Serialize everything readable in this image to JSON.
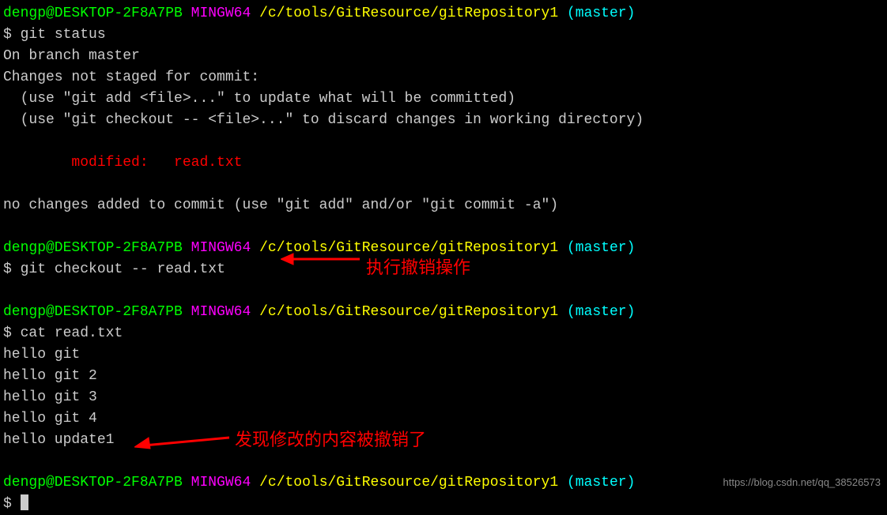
{
  "prompt": {
    "user_host": "dengp@DESKTOP-2F8A7PB",
    "shell": "MINGW64",
    "path": "/c/tools/GitResource/gitRepository1",
    "branch": "(master)",
    "dollar": "$"
  },
  "commands": {
    "status": "git status",
    "checkout": "git checkout -- read.txt",
    "cat": "cat read.txt"
  },
  "output": {
    "on_branch": "On branch master",
    "changes_header": "Changes not staged for commit:",
    "hint_add": "  (use \"git add <file>...\" to update what will be committed)",
    "hint_checkout": "  (use \"git checkout -- <file>...\" to discard changes in working directory)",
    "modified": "        modified:   read.txt",
    "no_changes": "no changes added to commit (use \"git add\" and/or \"git commit -a\")",
    "cat_l1": "hello git",
    "cat_l2": "hello git 2",
    "cat_l3": "hello git 3",
    "cat_l4": "hello git 4",
    "cat_l5": "hello update1"
  },
  "annotations": {
    "a1": "执行撤销操作",
    "a2": "发现修改的内容被撤销了"
  },
  "watermark": "https://blog.csdn.net/qq_38526573"
}
